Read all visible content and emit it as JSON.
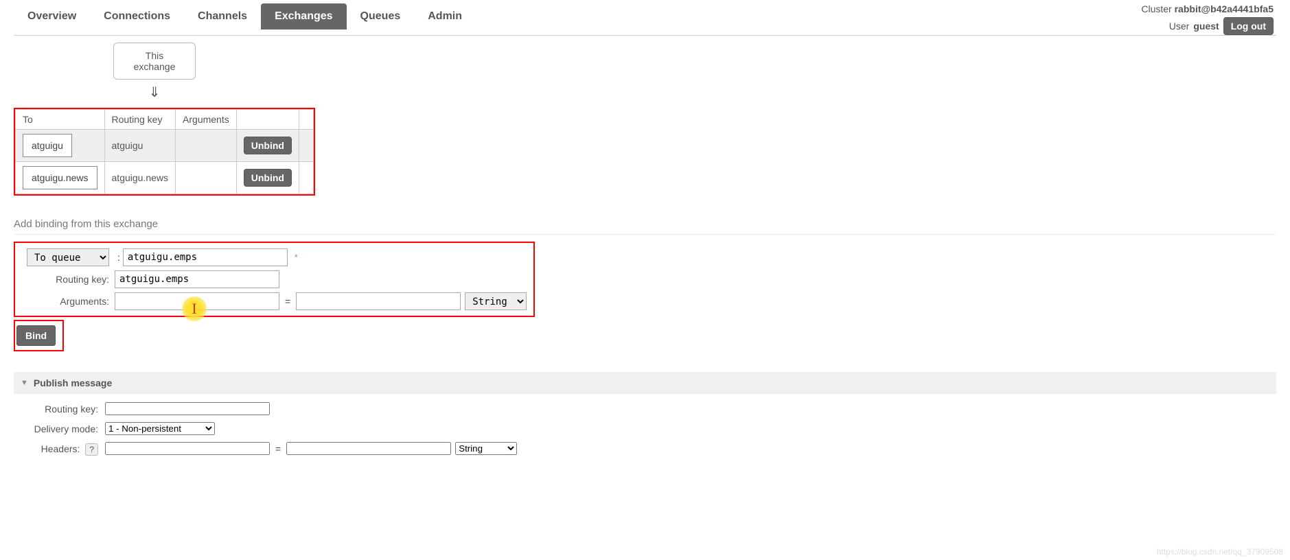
{
  "cluster": {
    "label": "Cluster",
    "name": "rabbit@b42a4441bfa5"
  },
  "user": {
    "label": "User",
    "name": "guest",
    "logout": "Log out"
  },
  "tabs": {
    "overview": "Overview",
    "connections": "Connections",
    "channels": "Channels",
    "exchanges": "Exchanges",
    "queues": "Queues",
    "admin": "Admin"
  },
  "this_exchange": "This exchange",
  "bindings_table": {
    "headers": {
      "to": "To",
      "routing_key": "Routing key",
      "arguments": "Arguments"
    },
    "rows": [
      {
        "to": "atguigu",
        "routing_key": "atguigu",
        "arguments": "",
        "action": "Unbind"
      },
      {
        "to": "atguigu.news",
        "routing_key": "atguigu.news",
        "arguments": "",
        "action": "Unbind"
      }
    ]
  },
  "add_binding": {
    "title": "Add binding from this exchange",
    "to_select": "To queue",
    "to_value": "atguigu.emps",
    "routing_key_label": "Routing key:",
    "routing_key_value": "atguigu.emps",
    "arguments_label": "Arguments:",
    "arg_key": "",
    "arg_val": "",
    "arg_type": "String",
    "bind_button": "Bind"
  },
  "publish": {
    "title": "Publish message",
    "routing_key_label": "Routing key:",
    "routing_key_value": "",
    "delivery_mode_label": "Delivery mode:",
    "delivery_mode_value": "1 - Non-persistent",
    "headers_label": "Headers:",
    "headers_help": "?",
    "header_key": "",
    "header_val": "",
    "header_type": "String"
  },
  "watermark": "https://blog.csdn.net/qq_37909508"
}
